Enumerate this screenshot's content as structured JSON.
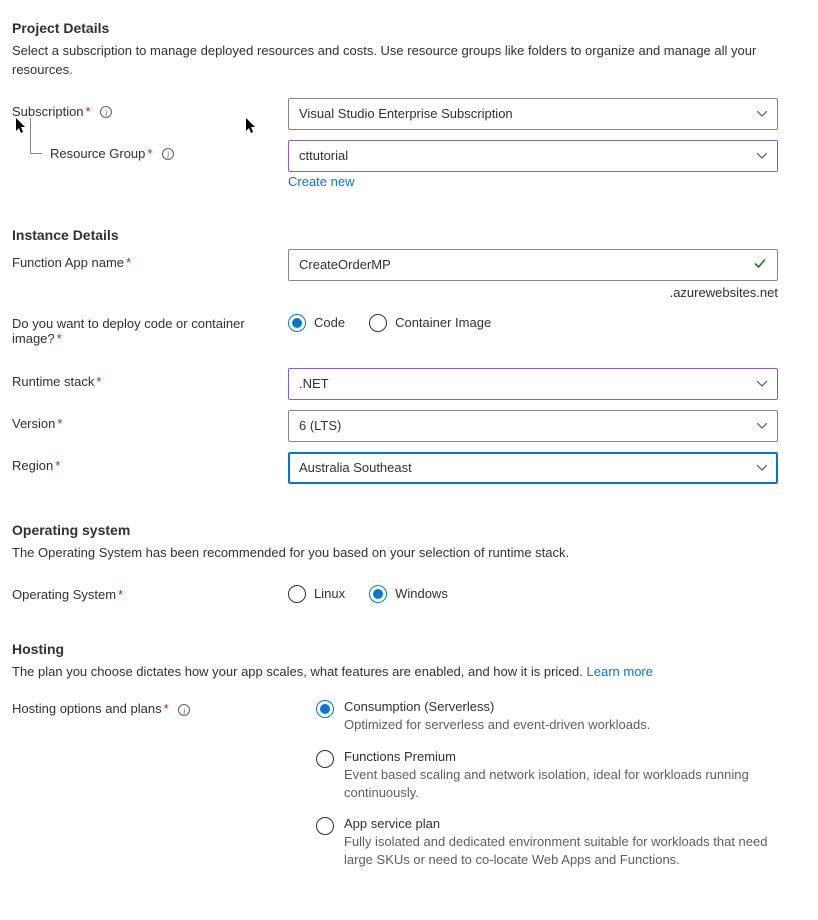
{
  "project": {
    "title": "Project Details",
    "desc": "Select a subscription to manage deployed resources and costs. Use resource groups like folders to organize and manage all your resources.",
    "subscription_label": "Subscription",
    "subscription_value": "Visual Studio Enterprise Subscription",
    "resource_group_label": "Resource Group",
    "resource_group_value": "cttutorial",
    "create_new": "Create new"
  },
  "instance": {
    "title": "Instance Details",
    "fn_name_label": "Function App name",
    "fn_name_value": "CreateOrderMP",
    "suffix": ".azurewebsites.net",
    "deploy_label": "Do you want to deploy code or container image?",
    "deploy_options": {
      "code": "Code",
      "container": "Container Image"
    },
    "runtime_label": "Runtime stack",
    "runtime_value": ".NET",
    "version_label": "Version",
    "version_value": "6 (LTS)",
    "region_label": "Region",
    "region_value": "Australia Southeast"
  },
  "os": {
    "title": "Operating system",
    "desc": "The Operating System has been recommended for you based on your selection of runtime stack.",
    "label": "Operating System",
    "options": {
      "linux": "Linux",
      "windows": "Windows"
    }
  },
  "hosting": {
    "title": "Hosting",
    "desc": "The plan you choose dictates how your app scales, what features are enabled, and how it is priced. ",
    "learn_more": "Learn more",
    "label": "Hosting options and plans",
    "options": [
      {
        "title": "Consumption (Serverless)",
        "desc": "Optimized for serverless and event-driven workloads."
      },
      {
        "title": "Functions Premium",
        "desc": "Event based scaling and network isolation, ideal for workloads running continuously."
      },
      {
        "title": "App service plan",
        "desc": "Fully isolated and dedicated environment suitable for workloads that need large SKUs or need to co-locate Web Apps and Functions."
      }
    ]
  }
}
